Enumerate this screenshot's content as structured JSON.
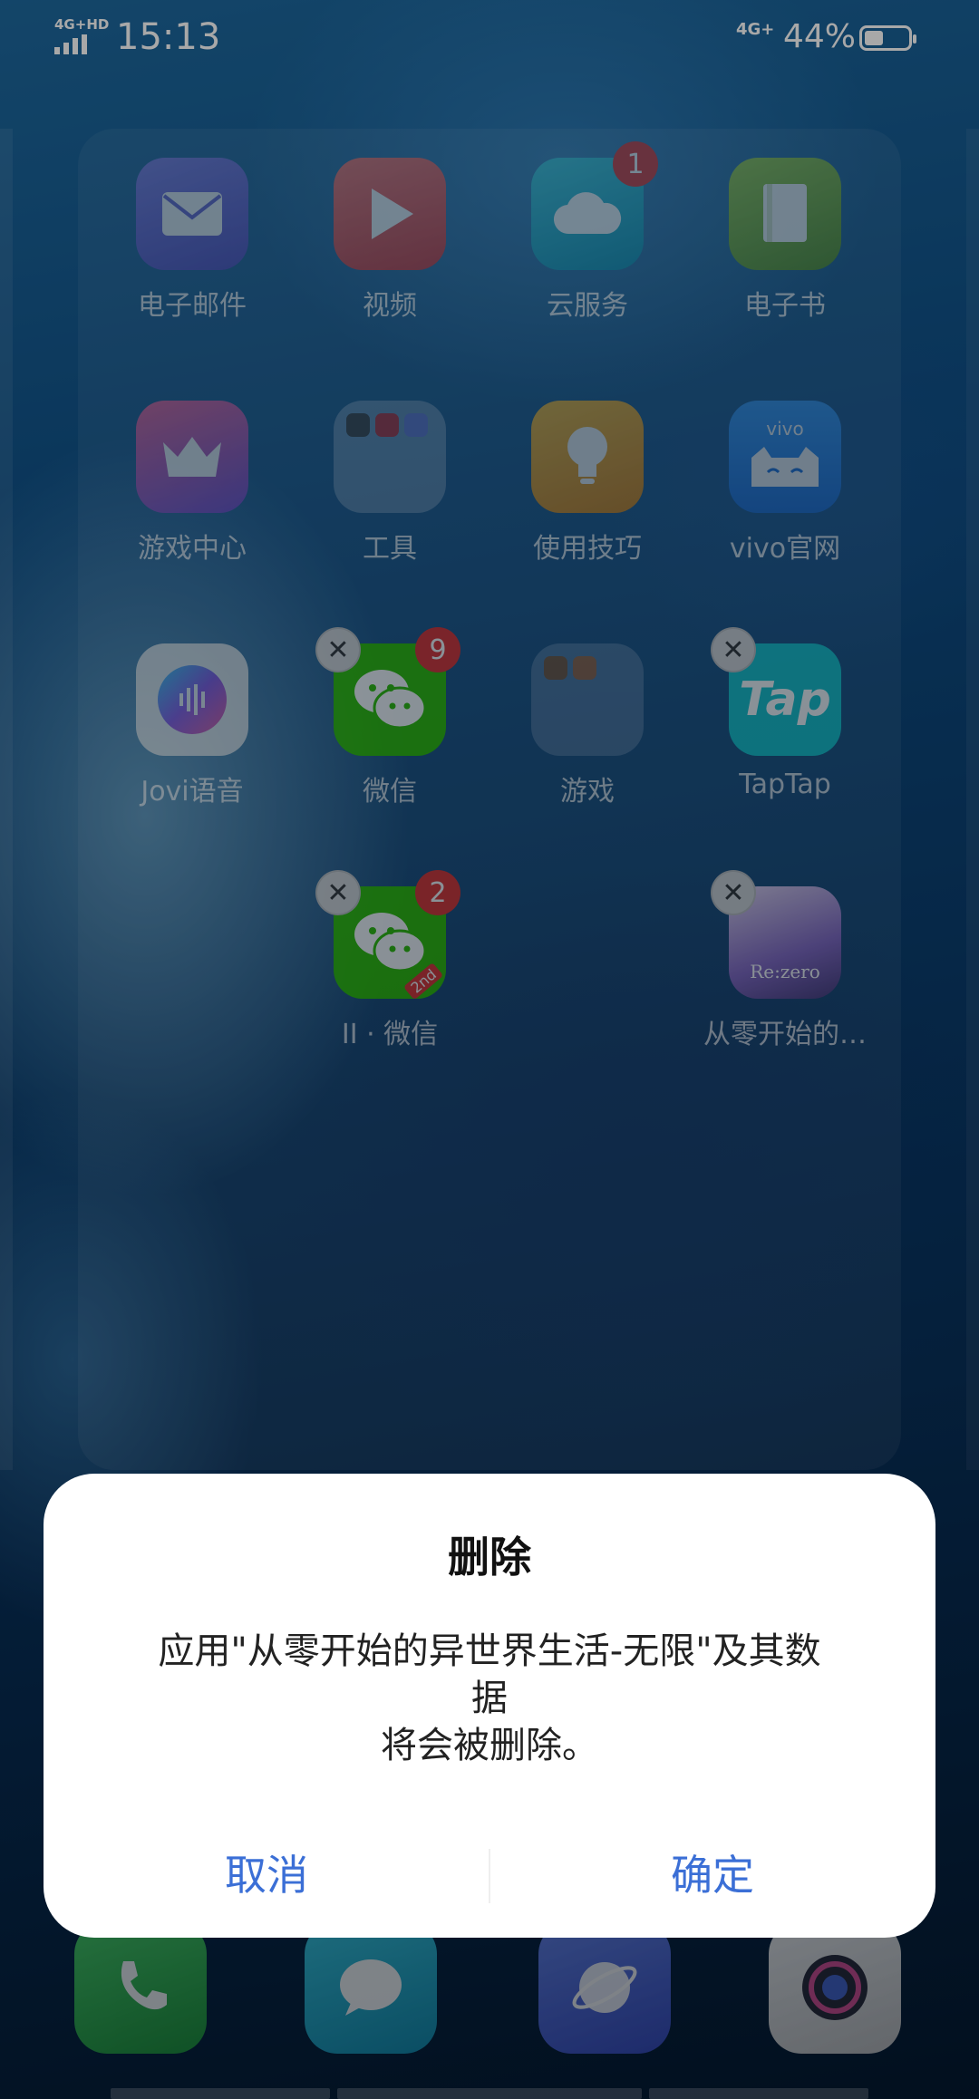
{
  "status_bar": {
    "network_left": "4G+HD",
    "time": "15:13",
    "network_right": "4G+",
    "battery_percent": "44%",
    "battery_level": 0.44
  },
  "apps": [
    {
      "label": "电子邮件",
      "icon": "mail-icon",
      "badge": null,
      "removable": false,
      "color": "#6f6ad8"
    },
    {
      "label": "视频",
      "icon": "video-play-icon",
      "badge": null,
      "removable": false,
      "color": "#e8504f"
    },
    {
      "label": "云服务",
      "icon": "cloud-icon",
      "badge": "1",
      "removable": false,
      "color": "#18b0c8"
    },
    {
      "label": "电子书",
      "icon": "book-icon",
      "badge": null,
      "removable": false,
      "color": "#7fb43a"
    },
    {
      "label": "游戏中心",
      "icon": "crown-icon",
      "badge": null,
      "removable": false,
      "color": "#e0508a"
    },
    {
      "label": "工具",
      "icon": "folder-icon",
      "badge": null,
      "removable": false,
      "color": "#8fa6c0"
    },
    {
      "label": "使用技巧",
      "icon": "lightbulb-icon",
      "badge": null,
      "removable": false,
      "color": "#f2a021"
    },
    {
      "label": "vivo官网",
      "icon": "vivo-cat-icon",
      "badge": null,
      "removable": false,
      "color": "#2f8ff0"
    },
    {
      "label": "Jovi语音",
      "icon": "voice-wave-icon",
      "badge": null,
      "removable": false,
      "color": "#f2f2f2"
    },
    {
      "label": "微信",
      "icon": "wechat-icon",
      "badge": "9",
      "removable": true,
      "color": "#2dc100"
    },
    {
      "label": "游戏",
      "icon": "game-folder-icon",
      "badge": null,
      "removable": false,
      "color": "#8fa6c0"
    },
    {
      "label": "TapTap",
      "icon": "taptap-icon",
      "badge": null,
      "removable": true,
      "color": "#15c5ce"
    },
    {
      "label": "II · 微信",
      "icon": "wechat-clone-icon",
      "badge": "2",
      "removable": true,
      "color": "#2dc100"
    },
    {
      "label": "从零开始的…",
      "icon": "rezero-game-icon",
      "badge": null,
      "removable": true,
      "color": "#b58ad6"
    }
  ],
  "taptap_text": "Tap",
  "vivo_text": "vivo",
  "rezero_text": "Re:zero",
  "clone_tag": "2nd",
  "dock": [
    {
      "icon": "phone-icon",
      "color": "#2fb54a"
    },
    {
      "icon": "message-icon",
      "color": "#1fa6c6"
    },
    {
      "icon": "browser-icon",
      "color": "#4a68d8"
    },
    {
      "icon": "camera-icon",
      "color": "#e8e8e8"
    }
  ],
  "dialog": {
    "title": "删除",
    "message_line1": "应用\"从零开始的异世界生活-无限\"及其数",
    "message_line2": "据",
    "message_line3": "将会被删除。",
    "cancel_label": "取消",
    "confirm_label": "确定",
    "button_color": "#3b6fd6"
  }
}
